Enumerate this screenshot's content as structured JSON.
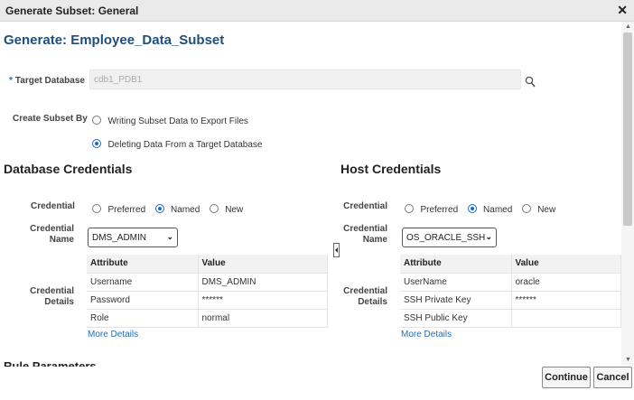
{
  "dialog": {
    "title": "Generate Subset: General",
    "close_glyph": "✕"
  },
  "page": {
    "heading": "Generate: Employee_Data_Subset"
  },
  "target": {
    "required_mark": "*",
    "label": "Target Database",
    "value": "cdb1_PDB1"
  },
  "create_subset": {
    "label": "Create Subset By",
    "options": [
      "Writing Subset Data to Export Files",
      "Deleting Data From a Target Database"
    ],
    "selected": "Deleting Data From a Target Database"
  },
  "database_credentials": {
    "heading": "Database Credentials",
    "credential_label": "Credential",
    "options": [
      "Preferred",
      "Named",
      "New"
    ],
    "selected": "Named",
    "name_label_1": "Credential",
    "name_label_2": "Name",
    "name_value": "DMS_ADMIN",
    "details_label_1": "Credential",
    "details_label_2": "Details",
    "columns": [
      "Attribute",
      "Value"
    ],
    "rows": [
      [
        "Username",
        "DMS_ADMIN"
      ],
      [
        "Password",
        "******"
      ],
      [
        "Role",
        "normal"
      ]
    ],
    "more_link": "More Details"
  },
  "host_credentials": {
    "heading": "Host Credentials",
    "credential_label": "Credential",
    "options": [
      "Preferred",
      "Named",
      "New"
    ],
    "selected": "Named",
    "name_label_1": "Credential",
    "name_label_2": "Name",
    "name_value": "OS_ORACLE_SSH",
    "details_label_1": "Credential",
    "details_label_2": "Details",
    "columns": [
      "Attribute",
      "Value"
    ],
    "rows": [
      [
        "UserName",
        "oracle"
      ],
      [
        "SSH Private Key",
        "******"
      ],
      [
        "SSH Public Key",
        ""
      ]
    ],
    "more_link": "More Details"
  },
  "rule_parameters": {
    "heading": "Rule Parameters"
  },
  "buttons": {
    "continue": "Continue",
    "cancel": "Cancel"
  },
  "colors": {
    "heading": "#1f4f7a",
    "link": "#1f6fb3",
    "radio_selected": "#1b6ac9"
  },
  "icons": {
    "search": "search-icon",
    "close": "close-icon"
  }
}
